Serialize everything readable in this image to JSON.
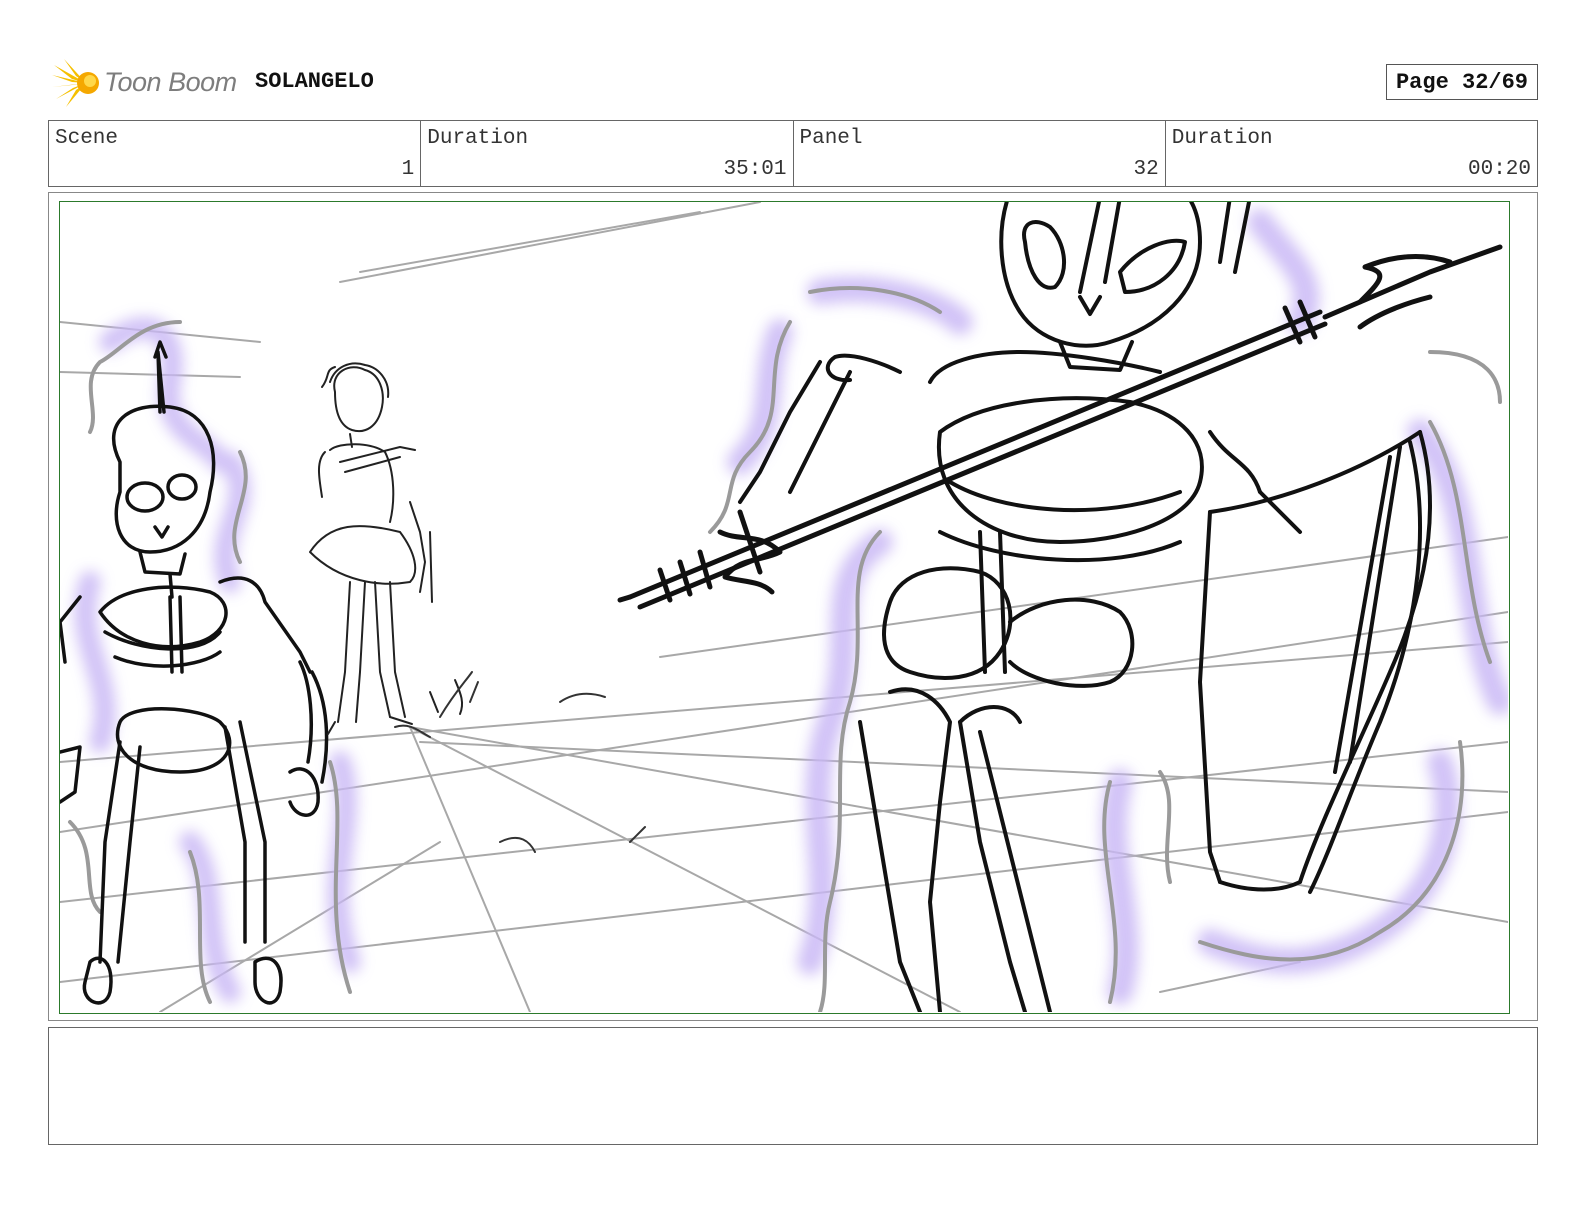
{
  "header": {
    "logo_text": "Toon Boom",
    "project_name": "SOLANGELO",
    "page_label": "Page 32/69"
  },
  "info": {
    "scene_label": "Scene",
    "scene_value": "1",
    "scene_duration_label": "Duration",
    "scene_duration_value": "35:01",
    "panel_label": "Panel",
    "panel_value": "32",
    "panel_duration_label": "Duration",
    "panel_duration_value": "00:20"
  },
  "notes": {
    "text": ""
  },
  "colors": {
    "frame_border": "#2c7a2c",
    "aura": "#c9b8f5",
    "logo_yellow": "#f5c000"
  }
}
